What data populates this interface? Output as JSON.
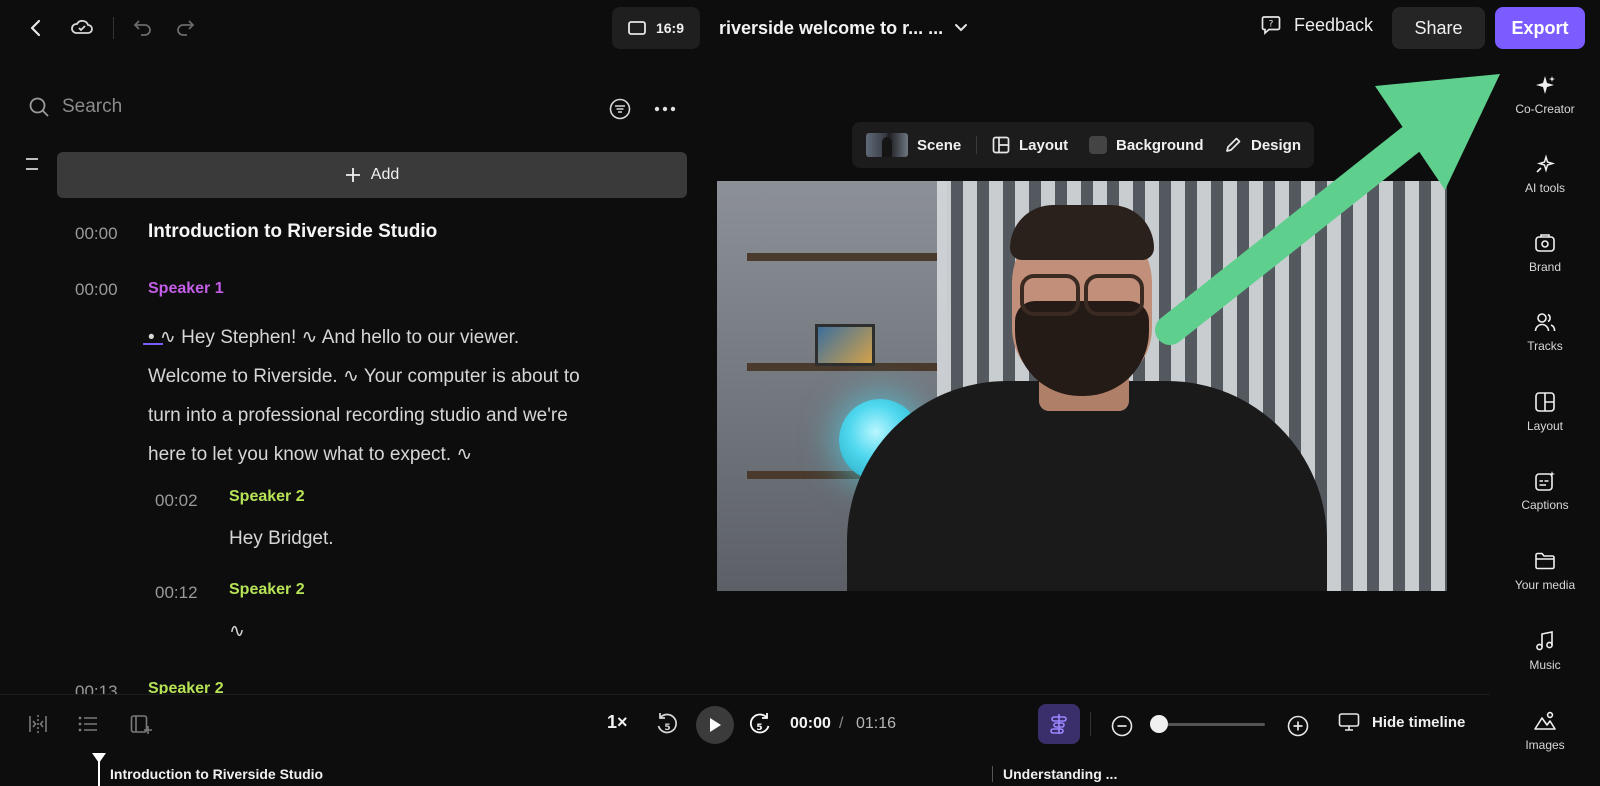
{
  "topbar": {
    "aspect_ratio": "16:9",
    "project_title": "riverside welcome to r... ...",
    "feedback_label": "Feedback",
    "share_label": "Share",
    "export_label": "Export"
  },
  "transcript": {
    "search_placeholder": "Search",
    "add_label": "Add",
    "chapter": {
      "time": "00:00",
      "title": "Introduction to Riverside Studio"
    },
    "entries": [
      {
        "time": "00:00",
        "speaker": "Speaker 1",
        "lines": [
          "• ∿ Hey Stephen! ∿ And hello to our viewer.",
          "Welcome to Riverside. ∿ Your computer is about to",
          "turn into a professional recording studio and we're",
          "here to let you know what to expect. ∿"
        ]
      },
      {
        "time": "00:02",
        "speaker": "Speaker 2",
        "text": "Hey Bridget."
      },
      {
        "time": "00:12",
        "speaker": "Speaker 2",
        "text": "∿"
      },
      {
        "time": "00:13",
        "speaker": "Speaker 2"
      }
    ]
  },
  "video_toolbar": {
    "scene_label": "Scene",
    "layout_label": "Layout",
    "background_label": "Background",
    "design_label": "Design"
  },
  "playback": {
    "speed": "1×",
    "skip_back_seconds": "5",
    "skip_forward_seconds": "5",
    "current_time": "00:00",
    "separator": "/",
    "total_time": "01:16",
    "zoom_level": 0,
    "hide_timeline_label": "Hide timeline"
  },
  "timeline": {
    "clips": [
      "Introduction to Riverside Studio",
      "Understanding ..."
    ]
  },
  "sidebar": {
    "items": [
      {
        "label": "Co-Creator",
        "icon": "sparkle-icon"
      },
      {
        "label": "AI tools",
        "icon": "ai-tools-icon"
      },
      {
        "label": "Brand",
        "icon": "brand-icon"
      },
      {
        "label": "Tracks",
        "icon": "tracks-icon"
      },
      {
        "label": "Layout",
        "icon": "layout-icon"
      },
      {
        "label": "Captions",
        "icon": "captions-icon"
      },
      {
        "label": "Your media",
        "icon": "folder-icon"
      },
      {
        "label": "Music",
        "icon": "music-icon"
      },
      {
        "label": "Images",
        "icon": "images-icon"
      }
    ]
  },
  "colors": {
    "accent": "#7c5cff",
    "speaker1": "#c45ee8",
    "speaker2": "#b6e356",
    "annotation_arrow": "#5fcf8e"
  }
}
